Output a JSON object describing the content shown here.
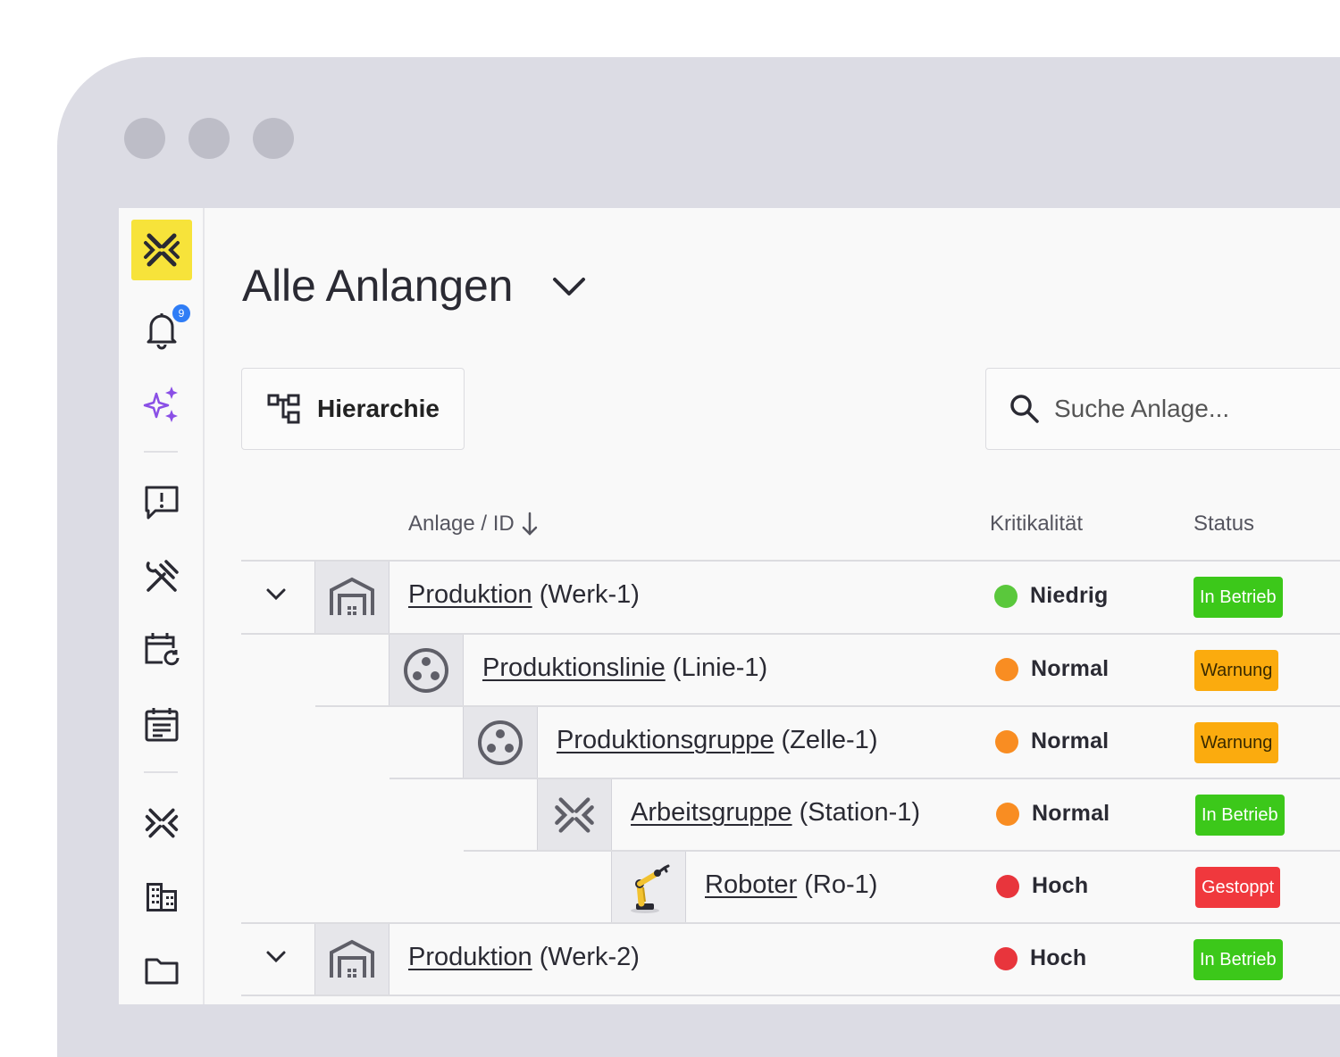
{
  "sidebar": {
    "notification_count": "9",
    "items": [
      {
        "icon": "logo-icon"
      },
      {
        "icon": "bell-icon"
      },
      {
        "icon": "sparkle-icon"
      },
      {
        "icon": "message-alert-icon"
      },
      {
        "icon": "tools-icon"
      },
      {
        "icon": "calendar-refresh-icon"
      },
      {
        "icon": "calendar-list-icon"
      },
      {
        "icon": "asset-icon"
      },
      {
        "icon": "building-icon"
      },
      {
        "icon": "folder-icon"
      }
    ]
  },
  "header": {
    "title": "Alle Anlangen"
  },
  "toolbar": {
    "hierarchy_label": "Hierarchie",
    "search_placeholder": "Suche Anlage..."
  },
  "table": {
    "columns": {
      "asset": "Anlage / ID",
      "criticality": "Kritikalität",
      "status": "Status"
    },
    "rows": [
      {
        "name": "Produktion",
        "id": "(Werk-1)",
        "criticality": "Niedrig",
        "crit_color": "#5ac83c",
        "status": "In Betrieb",
        "status_color": "#3cc81a",
        "icon": "warehouse-icon"
      },
      {
        "name": "Produktionslinie",
        "id": "(Linie-1)",
        "criticality": "Normal",
        "crit_color": "#f98d22",
        "status": "Warnung",
        "status_color": "#fbab0e",
        "icon": "production-line-icon"
      },
      {
        "name": "Produktionsgruppe",
        "id": "(Zelle-1)",
        "criticality": "Normal",
        "crit_color": "#f98d22",
        "status": "Warnung",
        "status_color": "#fbab0e",
        "icon": "production-group-icon"
      },
      {
        "name": "Arbeitsgruppe",
        "id": "(Station-1)",
        "criticality": "Normal",
        "crit_color": "#f98d22",
        "status": "In Betrieb",
        "status_color": "#3cc81a",
        "icon": "workgroup-icon"
      },
      {
        "name": "Roboter",
        "id": "(Ro-1)",
        "criticality": "Hoch",
        "crit_color": "#e8353c",
        "status": "Gestoppt",
        "status_color": "#f0383d",
        "icon": "robot-arm-icon"
      },
      {
        "name": "Produktion",
        "id": "(Werk-2)",
        "criticality": "Hoch",
        "crit_color": "#e8353c",
        "status": "In Betrieb",
        "status_color": "#3cc81a",
        "icon": "warehouse-icon"
      }
    ]
  }
}
